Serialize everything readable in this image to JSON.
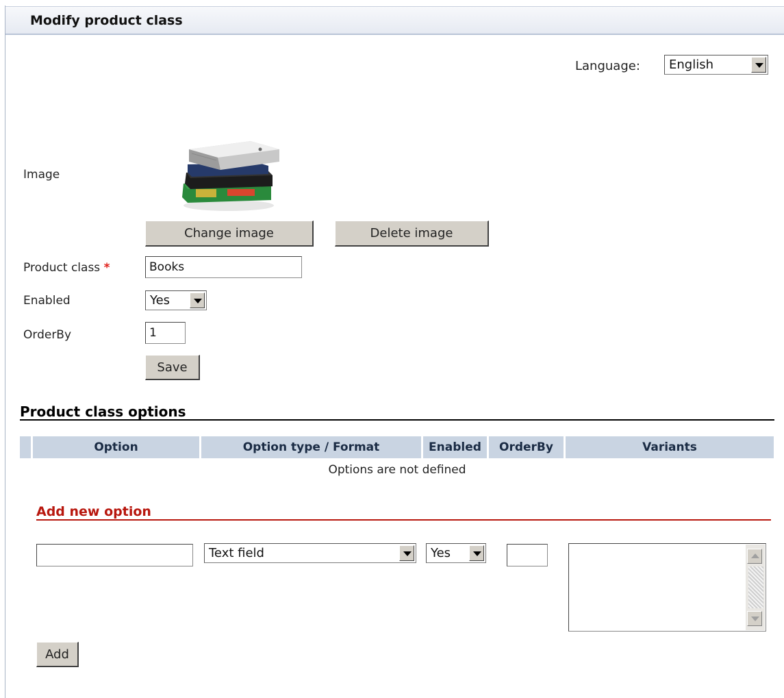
{
  "header": {
    "title": "Modify product class"
  },
  "language": {
    "label": "Language:",
    "value": "English"
  },
  "image": {
    "label": "Image",
    "change_label": "Change image",
    "delete_label": "Delete image"
  },
  "form": {
    "product_class_label": "Product class",
    "required_mark": "*",
    "product_class_value": "Books",
    "enabled_label": "Enabled",
    "enabled_value": "Yes",
    "orderby_label": "OrderBy",
    "orderby_value": "1",
    "save_label": "Save"
  },
  "options": {
    "title": "Product class options",
    "columns": [
      "Option",
      "Option type / Format",
      "Enabled",
      "OrderBy",
      "Variants"
    ],
    "empty_text": "Options are not defined"
  },
  "add_option": {
    "title": "Add new option",
    "name_value": "",
    "type_value": "Text field",
    "enabled_value": "Yes",
    "orderby_value": "",
    "variants_value": "",
    "add_label": "Add"
  },
  "colors": {
    "header_bg": "#e6eaf2",
    "table_header_bg": "#c9d4e2",
    "add_title": "#b8170e",
    "required": "#e0201a",
    "button_face": "#d4d0c8"
  }
}
